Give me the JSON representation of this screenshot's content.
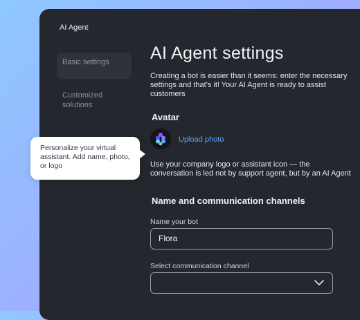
{
  "app": {
    "title": "AI Agent"
  },
  "sidebar": {
    "items": [
      {
        "label": "Basic settings"
      },
      {
        "label": "Customized solutions"
      }
    ]
  },
  "main": {
    "title": "AI Agent settings",
    "intro": "Creating a bot is easier than it seems: enter the necessary settings and that's it! Your AI Agent is ready to assist customers",
    "avatar": {
      "title": "Avatar",
      "upload_label": "Upload photo",
      "note": "Use your company logo or assistant icon — the conversation is led not by support agent, but by an AI Agent"
    },
    "channels": {
      "title": "Name and communication channels",
      "name_label": "Name your bot",
      "name_value": "Flora",
      "channel_label": "Select communication channel",
      "channel_value": ""
    }
  },
  "tooltip": {
    "text": "Personalize your virtual assistant. Add name, photo, or logo"
  },
  "colors": {
    "accent": "#5da2ff",
    "window": "#25272e",
    "avatar_logo": "#7d63ff"
  }
}
